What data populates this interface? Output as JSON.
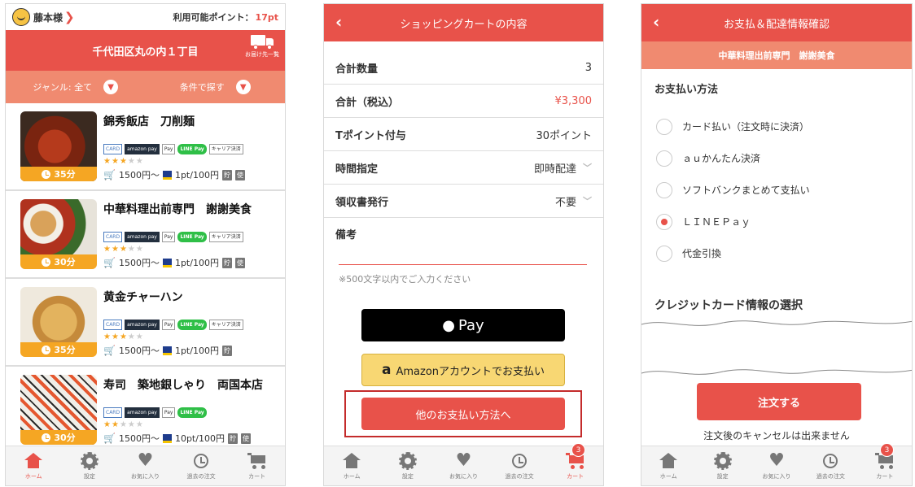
{
  "screen1": {
    "user_name": "藤本様",
    "points_label": "利用可能ポイント：",
    "points_value": "17pt",
    "address": "千代田区丸の内１丁目",
    "delivery_list_label": "お届け先一覧",
    "genre_filter": "ジャンル: 全て",
    "condition_filter": "条件で探す",
    "restaurants": [
      {
        "name": "錦秀飯店　刀削麺",
        "time": "35分",
        "rating": 3,
        "min_price": "1500円～",
        "points": "1pt/100円",
        "tags": [
          "貯",
          "使"
        ],
        "payments": [
          "CARD",
          "amazon pay",
          "Pay",
          "LINE Pay",
          "キャリア決済"
        ]
      },
      {
        "name": "中華料理出前専門　謝謝美食",
        "time": "30分",
        "rating": 3,
        "min_price": "1500円～",
        "points": "1pt/100円",
        "tags": [
          "貯",
          "使"
        ],
        "payments": [
          "CARD",
          "amazon pay",
          "Pay",
          "LINE Pay",
          "キャリア決済"
        ]
      },
      {
        "name": "黄金チャーハン",
        "time": "35分",
        "rating": 3,
        "min_price": "1500円～",
        "points": "1pt/100円",
        "tags": [
          "貯"
        ],
        "payments": [
          "CARD",
          "amazon pay",
          "Pay",
          "LINE Pay",
          "キャリア決済"
        ]
      },
      {
        "name": "寿司　築地銀しゃり　両国本店",
        "time": "30分",
        "rating": 2,
        "min_price": "1500円～",
        "points": "10pt/100円",
        "tags": [
          "貯",
          "使"
        ],
        "payments": [
          "CARD",
          "amazon pay",
          "Pay",
          "LINE Pay"
        ]
      }
    ],
    "tabs": [
      "ホーム",
      "設定",
      "お気に入り",
      "過去の注文",
      "カート"
    ]
  },
  "screen2": {
    "title": "ショッピングカートの内容",
    "rows": [
      {
        "label": "合計数量",
        "value": "3"
      },
      {
        "label": "合計（税込）",
        "value": "¥3,300"
      },
      {
        "label": "Tポイント付与",
        "value": "30ポイント"
      },
      {
        "label": "時間指定",
        "value": "即時配達"
      },
      {
        "label": "領収書発行",
        "value": "不要"
      }
    ],
    "note_label": "備考",
    "note_hint": "※500文字以内でご入力ください",
    "apple_pay_label": "Pay",
    "amazon_pay_label": "Amazonアカウントでお支払い",
    "other_payment_label": "他のお支払い方法へ",
    "cart_badge": "3",
    "tabs": [
      "ホーム",
      "設定",
      "お気に入り",
      "過去の注文",
      "カート"
    ]
  },
  "screen3": {
    "title": "お支払＆配達情報確認",
    "shop_name": "中華料理出前専門　謝謝美食",
    "payment_section_title": "お支払い方法",
    "payment_options": [
      "カード払い（注文時に決済）",
      "ａｕかんたん決済",
      "ソフトバンクまとめて支払い",
      "ＬＩＮＥＰａｙ",
      "代金引換"
    ],
    "selected_index": 3,
    "credit_section_title": "クレジットカード情報の選択",
    "order_button": "注文する",
    "cancel_note": "注文後のキャンセルは出来ません",
    "cart_badge": "3",
    "tabs": [
      "ホーム",
      "設定",
      "お気に入り",
      "過去の注文",
      "カート"
    ]
  }
}
